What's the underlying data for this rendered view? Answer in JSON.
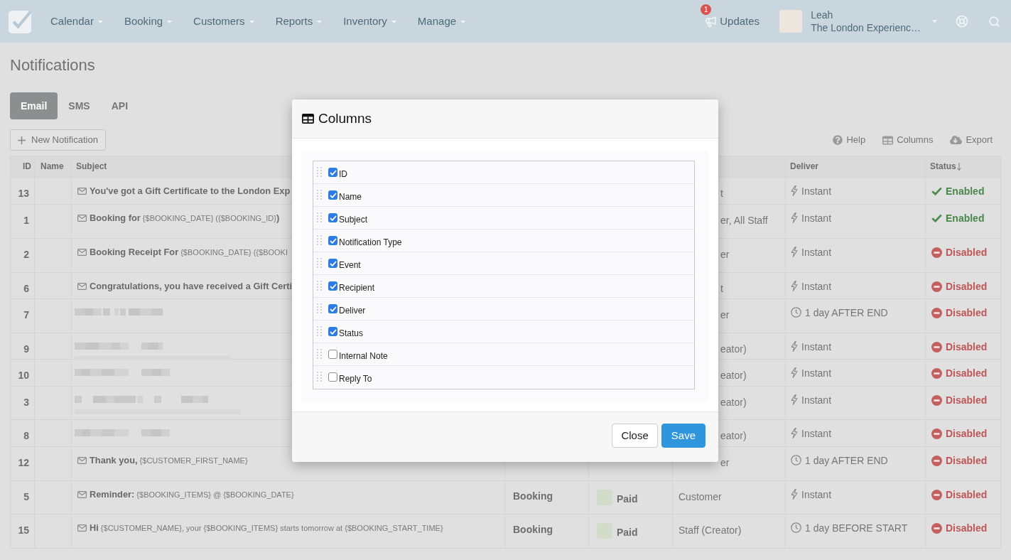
{
  "nav": {
    "menus": [
      {
        "label": "Calendar"
      },
      {
        "label": "Booking"
      },
      {
        "label": "Customers"
      },
      {
        "label": "Reports"
      },
      {
        "label": "Inventory"
      },
      {
        "label": "Manage"
      }
    ],
    "updates": {
      "label": "Updates",
      "badge": "1"
    },
    "user": {
      "name": "Leah",
      "company": "The London Experienc…"
    }
  },
  "page": {
    "title": "Notifications"
  },
  "tabs": [
    {
      "label": "Email",
      "selected": true
    },
    {
      "label": "SMS",
      "selected": false
    },
    {
      "label": "API",
      "selected": false
    }
  ],
  "new_notification_button": {
    "label": "New Notification"
  },
  "toolbar": [
    {
      "kind": "help",
      "label": "Help"
    },
    {
      "kind": "columns",
      "label": "Columns"
    },
    {
      "kind": "export",
      "label": "Export"
    }
  ],
  "table": {
    "columns": [
      {
        "label": "ID",
        "sorted": false
      },
      {
        "label": "Name",
        "sorted": false
      },
      {
        "label": "Subject",
        "sorted": false
      },
      {
        "label": "Deliver",
        "sorted": false
      },
      {
        "label": "Status",
        "sorted": true
      }
    ],
    "rows": [
      {
        "id": "13",
        "kind": "text",
        "subject": "You've got a Gift Certificate to the London Exp",
        "recipient": "t",
        "deliver": {
          "kind": "instant",
          "text": "Instant"
        },
        "status": {
          "enabled": true,
          "label": "Enabled"
        }
      },
      {
        "id": "1",
        "kind": "template",
        "subject": "**Booking for** {$BOOKING_DATE} ({$BOOKING_ID}**)**",
        "recipient": "er, All Staff",
        "deliver": {
          "kind": "instant",
          "text": "Instant"
        },
        "status": {
          "enabled": true,
          "label": "Enabled"
        }
      },
      {
        "id": "2",
        "kind": "template",
        "subject": "**Booking Receipt For** {$BOOKING_DATE} ({$BOOKI",
        "recipient": "er",
        "deliver": {
          "kind": "instant",
          "text": "Instant"
        },
        "status": {
          "enabled": false,
          "label": "Disabled"
        }
      },
      {
        "id": "6",
        "kind": "text",
        "subject": "Congratulations, you have received a Gift Certi",
        "recipient": "t",
        "deliver": {
          "kind": "instant",
          "text": "Instant"
        },
        "status": {
          "enabled": false,
          "label": "Disabled"
        }
      },
      {
        "id": "7",
        "kind": "redacted",
        "recipient": "er",
        "deliver": {
          "kind": "scheduled",
          "text": "1 day AFTER END"
        },
        "status": {
          "enabled": false,
          "label": "Disabled"
        }
      },
      {
        "id": "9",
        "kind": "redacted",
        "recipient": "eator)",
        "deliver": {
          "kind": "instant",
          "text": "Instant"
        },
        "status": {
          "enabled": false,
          "label": "Disabled"
        }
      },
      {
        "id": "10",
        "kind": "redacted",
        "recipient": "eator)",
        "deliver": {
          "kind": "instant",
          "text": "Instant"
        },
        "status": {
          "enabled": false,
          "label": "Disabled"
        }
      },
      {
        "id": "3",
        "kind": "redacted",
        "recipient": "eator)",
        "deliver": {
          "kind": "instant",
          "text": "Instant"
        },
        "status": {
          "enabled": false,
          "label": "Disabled"
        }
      },
      {
        "id": "8",
        "kind": "redacted",
        "recipient": "eator)",
        "deliver": {
          "kind": "instant",
          "text": "Instant"
        },
        "status": {
          "enabled": false,
          "label": "Disabled"
        }
      },
      {
        "id": "12",
        "kind": "template",
        "subject": "**Thank you,** {$CUSTOMER_FIRST_NAME}",
        "recipient": "er",
        "deliver": {
          "kind": "scheduled",
          "text": "1 day AFTER END"
        },
        "status": {
          "enabled": false,
          "label": "Disabled"
        }
      },
      {
        "id": "5",
        "kind": "template",
        "subject": "**Reminder:** {$BOOKING_ITEMS} @ {$BOOKING_DATE}",
        "notification_type": "Booking",
        "event": {
          "label": "Paid",
          "color": "#d3dcc9"
        },
        "recipient": "Customer",
        "deliver": {
          "kind": "instant",
          "text": "Instant"
        },
        "status": {
          "enabled": false,
          "label": "Disabled"
        }
      },
      {
        "id": "15",
        "kind": "template",
        "subject": "**Hi** {$CUSTOMER_NAME}, your {$BOOKING_ITEMS} starts tomorrow at {$BOOKING_START_TIME}",
        "notification_type": "Booking",
        "event": {
          "label": "Paid",
          "color": "#d3dcc9"
        },
        "recipient": "Staff (Creator)",
        "deliver": {
          "kind": "scheduled",
          "text": "1 day BEFORE START"
        },
        "status": {
          "enabled": false,
          "label": "Disabled"
        }
      }
    ]
  },
  "columns_dialog": {
    "title": "Columns",
    "columns": [
      {
        "label": "ID",
        "checked": true
      },
      {
        "label": "Name",
        "checked": true
      },
      {
        "label": "Subject",
        "checked": true
      },
      {
        "label": "Notification Type",
        "checked": true
      },
      {
        "label": "Event",
        "checked": true
      },
      {
        "label": "Recipient",
        "checked": true
      },
      {
        "label": "Deliver",
        "checked": true
      },
      {
        "label": "Status",
        "checked": true
      },
      {
        "label": "Internal Note",
        "checked": false
      },
      {
        "label": "Reply To",
        "checked": false
      }
    ],
    "buttons": [
      {
        "kind": "secondary",
        "label": "Close"
      },
      {
        "kind": "primary",
        "label": "Save"
      }
    ]
  }
}
